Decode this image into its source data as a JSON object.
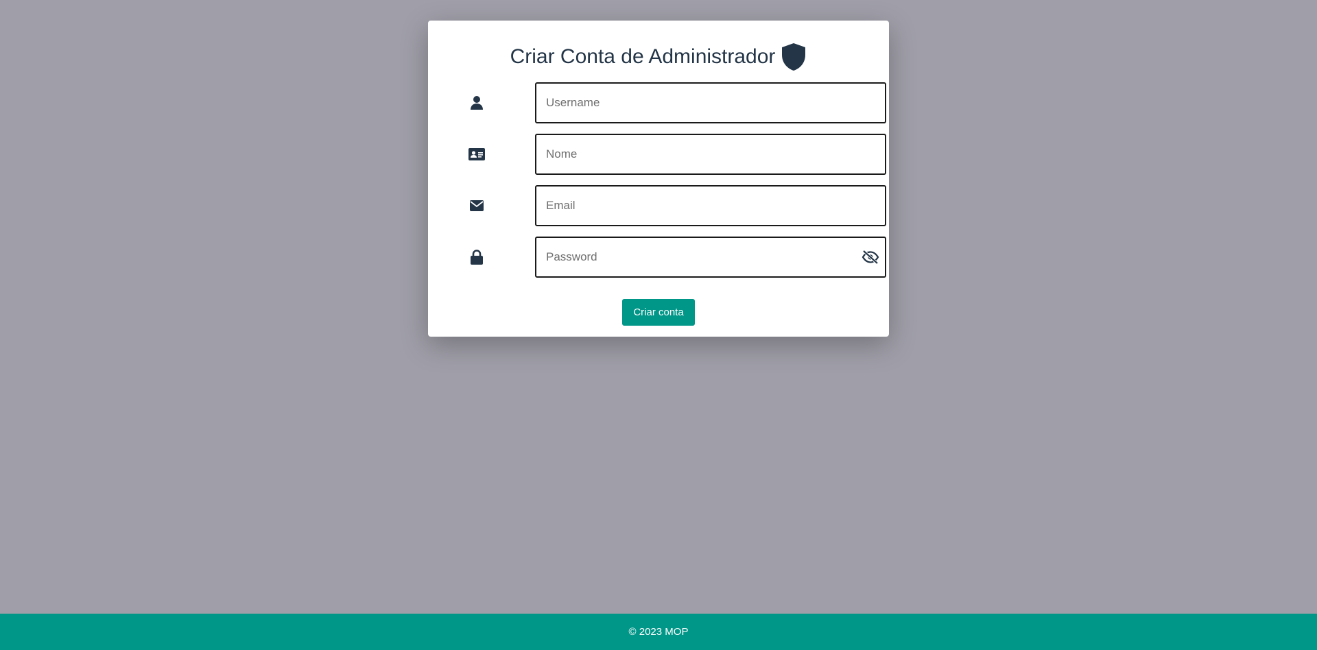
{
  "form": {
    "title": "Criar Conta de Administrador",
    "title_icon": "shield-icon",
    "fields": [
      {
        "icon": "user-icon",
        "placeholder": "Username",
        "value": ""
      },
      {
        "icon": "id-card-icon",
        "placeholder": "Nome",
        "value": ""
      },
      {
        "icon": "envelope-icon",
        "placeholder": "Email",
        "value": ""
      },
      {
        "icon": "lock-icon",
        "placeholder": "Password",
        "value": "",
        "toggle_icon": "eye-slash-icon"
      }
    ],
    "submit_label": "Criar conta"
  },
  "footer": {
    "text": "© 2023 MOP"
  },
  "colors": {
    "background": "#a09fa9",
    "card": "#ffffff",
    "accent": "#009688",
    "icon": "#233547",
    "title": "#233547"
  }
}
